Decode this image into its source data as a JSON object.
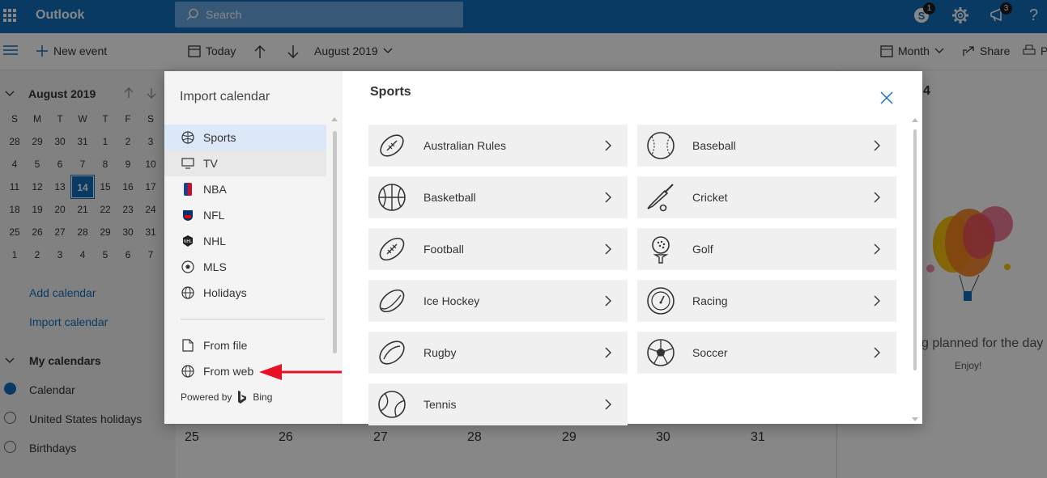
{
  "app": {
    "name": "Outlook",
    "search_placeholder": "Search",
    "skype_badge": "1",
    "notifications_badge": "3"
  },
  "commands": {
    "new_event": "New event",
    "today": "Today",
    "month_label": "August 2019",
    "view": "Month",
    "share": "Share",
    "print": "P"
  },
  "mini_calendar": {
    "title": "August 2019",
    "weekdays": [
      "S",
      "M",
      "T",
      "W",
      "T",
      "F",
      "S"
    ],
    "weeks": [
      [
        "28",
        "29",
        "30",
        "31",
        "1",
        "2",
        "3"
      ],
      [
        "4",
        "5",
        "6",
        "7",
        "8",
        "9",
        "10"
      ],
      [
        "11",
        "12",
        "13",
        "14",
        "15",
        "16",
        "17"
      ],
      [
        "18",
        "19",
        "20",
        "21",
        "22",
        "23",
        "24"
      ],
      [
        "25",
        "26",
        "27",
        "28",
        "29",
        "30",
        "31"
      ],
      [
        "1",
        "2",
        "3",
        "4",
        "5",
        "6",
        "7"
      ]
    ],
    "today": "14"
  },
  "sidebar": {
    "add_calendar": "Add calendar",
    "import_calendar": "Import calendar",
    "my_calendars": "My calendars",
    "calendars": [
      "Calendar",
      "United States holidays",
      "Birthdays"
    ]
  },
  "grid": {
    "bottom_dates": [
      "25",
      "26",
      "27",
      "28",
      "29",
      "30",
      "31"
    ],
    "right_date": "4"
  },
  "agenda": {
    "empty_text": "g planned for the day",
    "enjoy": "Enjoy!"
  },
  "modal": {
    "left_title": "Import calendar",
    "categories": [
      "Sports",
      "TV",
      "NBA",
      "NFL",
      "NHL",
      "MLS",
      "Holidays"
    ],
    "from_file": "From file",
    "from_web": "From web",
    "powered_by": "Powered by",
    "bing": "Bing",
    "right_title": "Sports",
    "sports": [
      {
        "label": "Australian Rules",
        "icon": "aussie-football-icon"
      },
      {
        "label": "Baseball",
        "icon": "baseball-icon"
      },
      {
        "label": "Basketball",
        "icon": "basketball-icon"
      },
      {
        "label": "Cricket",
        "icon": "cricket-icon"
      },
      {
        "label": "Football",
        "icon": "football-icon"
      },
      {
        "label": "Golf",
        "icon": "golf-icon"
      },
      {
        "label": "Ice Hockey",
        "icon": "hockey-puck-icon"
      },
      {
        "label": "Racing",
        "icon": "speedometer-icon"
      },
      {
        "label": "Rugby",
        "icon": "rugby-ball-icon"
      },
      {
        "label": "Soccer",
        "icon": "soccer-ball-icon"
      },
      {
        "label": "Tennis",
        "icon": "tennis-ball-icon"
      }
    ]
  },
  "colors": {
    "brand": "#106ebe",
    "annotation_arrow": "#e81123"
  }
}
